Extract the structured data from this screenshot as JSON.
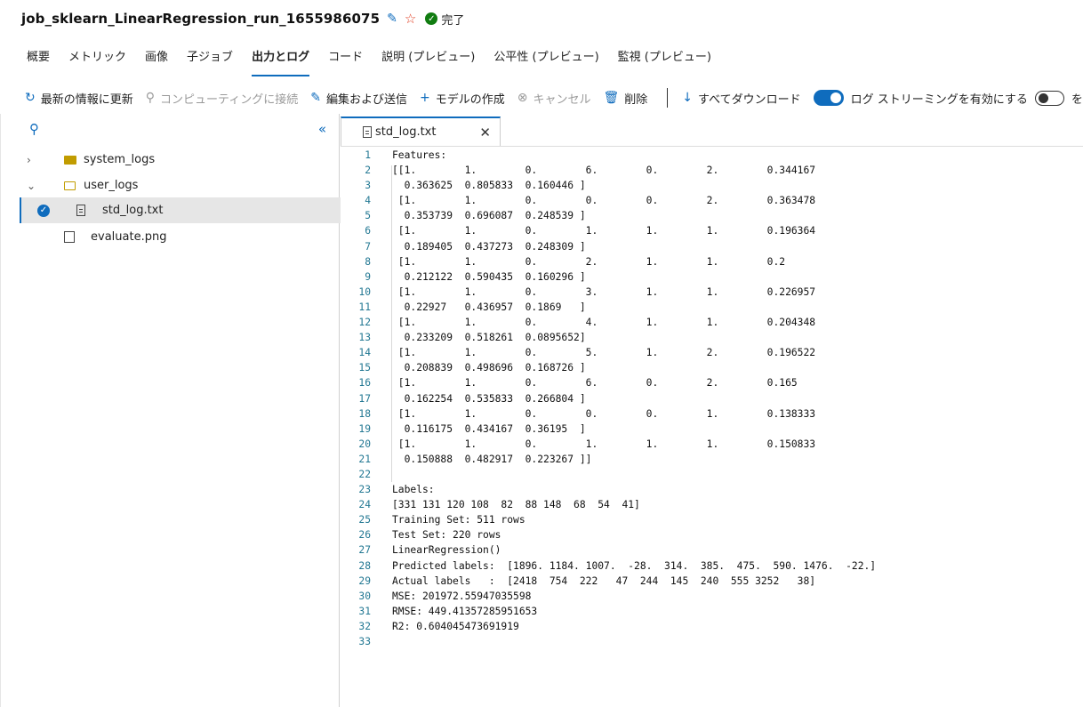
{
  "header": {
    "title": "job_sklearn_LinearRegression_run_1655986075",
    "status": "完了"
  },
  "tabs": [
    "概要",
    "メトリック",
    "画像",
    "子ジョブ",
    "出力とログ",
    "コード",
    "説明 (プレビュー)",
    "公平性 (プレビュー)",
    "監視 (プレビュー)"
  ],
  "active_tab": "出力とログ",
  "toolbar": {
    "refresh": "最新の情報に更新",
    "connect": "コンピューティングに接続",
    "edit": "編集および送信",
    "create_model": "モデルの作成",
    "cancel": "キャンセル",
    "delete": "削除",
    "download_all": "すべてダウンロード",
    "log_streaming": "ログ ストリーミングを有効にする",
    "trailing": "を"
  },
  "tree": [
    {
      "label": "system_logs",
      "type": "folder",
      "expanded": false
    },
    {
      "label": "user_logs",
      "type": "folder",
      "expanded": true
    },
    {
      "label": "std_log.txt",
      "type": "file",
      "selected": true
    },
    {
      "label": "evaluate.png",
      "type": "image"
    }
  ],
  "editor": {
    "tab_name": "std_log.txt",
    "lines": [
      "Features:",
      "[[1.        1.        0.        6.        0.        2.        0.344167",
      "  0.363625  0.805833  0.160446 ]",
      " [1.        1.        0.        0.        0.        2.        0.363478",
      "  0.353739  0.696087  0.248539 ]",
      " [1.        1.        0.        1.        1.        1.        0.196364",
      "  0.189405  0.437273  0.248309 ]",
      " [1.        1.        0.        2.        1.        1.        0.2",
      "  0.212122  0.590435  0.160296 ]",
      " [1.        1.        0.        3.        1.        1.        0.226957",
      "  0.22927   0.436957  0.1869   ]",
      " [1.        1.        0.        4.        1.        1.        0.204348",
      "  0.233209  0.518261  0.0895652]",
      " [1.        1.        0.        5.        1.        2.        0.196522",
      "  0.208839  0.498696  0.168726 ]",
      " [1.        1.        0.        6.        0.        2.        0.165",
      "  0.162254  0.535833  0.266804 ]",
      " [1.        1.        0.        0.        0.        1.        0.138333",
      "  0.116175  0.434167  0.36195  ]",
      " [1.        1.        0.        1.        1.        1.        0.150833",
      "  0.150888  0.482917  0.223267 ]]",
      "",
      "Labels:",
      "[331 131 120 108  82  88 148  68  54  41]",
      "Training Set: 511 rows",
      "Test Set: 220 rows",
      "LinearRegression()",
      "Predicted labels:  [1896. 1184. 1007.  -28.  314.  385.  475.  590. 1476.  -22.]",
      "Actual labels   :  [2418  754  222   47  244  145  240  555 3252   38]",
      "MSE: 201972.55947035598",
      "RMSE: 449.41357285951653",
      "R2: 0.604045473691919",
      ""
    ]
  }
}
